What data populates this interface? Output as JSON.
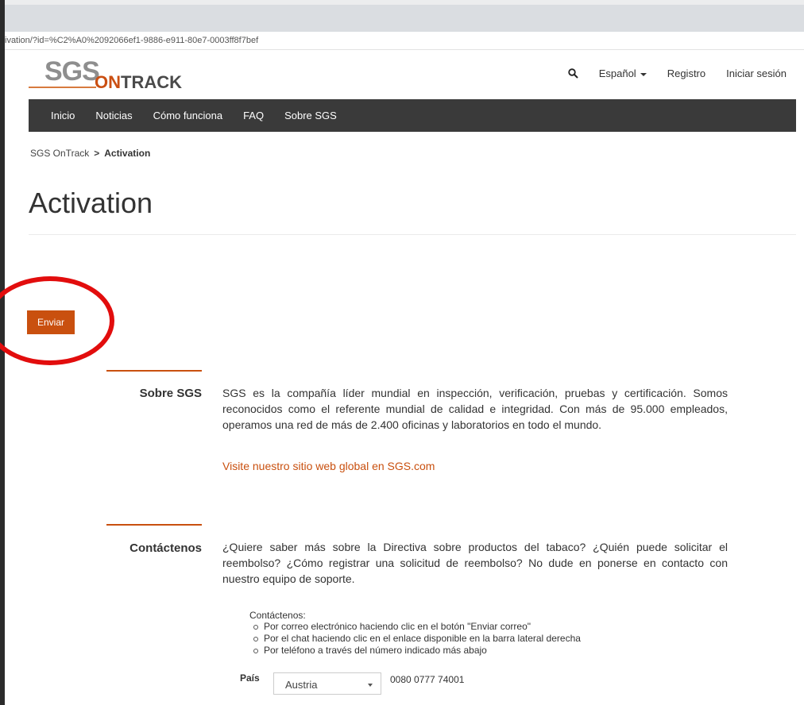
{
  "browser": {
    "url": "ivation/?id=%C2%A0%2092066ef1-9886-e911-80e7-0003ff8f7bef"
  },
  "logo": {
    "sgs": "SGS",
    "on": "ON",
    "track": "TRACK"
  },
  "topnav": {
    "language": "Español",
    "register": "Registro",
    "login": "Iniciar sesión"
  },
  "mainnav": [
    "Inicio",
    "Noticias",
    "Cómo funciona",
    "FAQ",
    "Sobre SGS"
  ],
  "breadcrumb": {
    "root": "SGS OnTrack",
    "sep": ">",
    "current": "Activation"
  },
  "page_title": "Activation",
  "submit_button": "Enviar",
  "about": {
    "label": "Sobre SGS",
    "text": "SGS es la compañía líder mundial en inspección, verificación, pruebas y certificación. Somos reconocidos como el referente mundial de calidad e integridad. Con más de 95.000 empleados, operamos una red de más de 2.400 oficinas y laboratorios en todo el mundo.",
    "link": "Visite nuestro sitio web global en SGS.com"
  },
  "contact": {
    "label": "Contáctenos",
    "text": "¿Quiere saber más sobre la Directiva sobre productos del tabaco? ¿Quién puede solicitar el reembolso? ¿Cómo registrar una solicitud de reembolso? No dude en ponerse en contacto con nuestro equipo de soporte.",
    "list_title": "Contáctenos:",
    "items": [
      "Por correo electrónico haciendo clic en el botón \"Enviar correo\"",
      "Por el chat haciendo clic en el enlace disponible en la barra lateral derecha",
      "Por teléfono a través del número indicado más abajo"
    ],
    "country_label": "País",
    "country_selected": "Austria",
    "phone": "0080 0777 74001"
  },
  "colors": {
    "accent": "#c9500f",
    "nav_bg": "#3a3a3a",
    "annotation_circle": "#e20d0d"
  }
}
